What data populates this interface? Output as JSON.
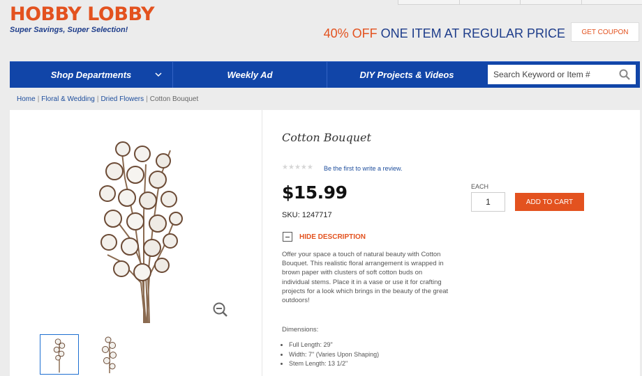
{
  "header": {
    "logo_text": "HOBBY LOBBY",
    "tagline": "Super Savings, Super Selection!",
    "promo_pct": "40% OFF",
    "promo_rest": " ONE ITEM AT REGULAR PRICE",
    "coupon_label": "GET COUPON"
  },
  "nav": {
    "items": [
      {
        "label": "Shop Departments"
      },
      {
        "label": "Weekly Ad"
      },
      {
        "label": "DIY Projects & Videos"
      }
    ],
    "search_placeholder": "Search Keyword or Item #"
  },
  "breadcrumb": [
    {
      "label": "Home"
    },
    {
      "label": "Floral & Wedding"
    },
    {
      "label": "Dried Flowers"
    },
    {
      "label": "Cotton Bouquet"
    }
  ],
  "product": {
    "title": "Cotton Bouquet",
    "rating_stars": 0,
    "review_text": "Be the first to write a review.",
    "price": "$15.99",
    "sku_label": "SKU:",
    "sku": "1247717",
    "qty_label": "EACH",
    "qty_value": "1",
    "add_to_cart": "ADD TO CART",
    "toggle_label": "HIDE DESCRIPTION",
    "description": "Offer your space a touch of natural beauty with Cotton Bouquet. This realistic floral arrangement is wrapped in brown paper with clusters of soft cotton buds on individual stems. Place it in a vase or use it for crafting projects for a look which brings in the beauty of the great outdoors!",
    "dimensions_label": "Dimensions:",
    "dimensions": [
      "Full Length: 29\"",
      "Width: 7\" (Varies Upon Shaping)",
      "Stem Length: 13 1/2\""
    ]
  },
  "colors": {
    "brand_orange": "#e3521f",
    "brand_blue": "#1145a8"
  }
}
